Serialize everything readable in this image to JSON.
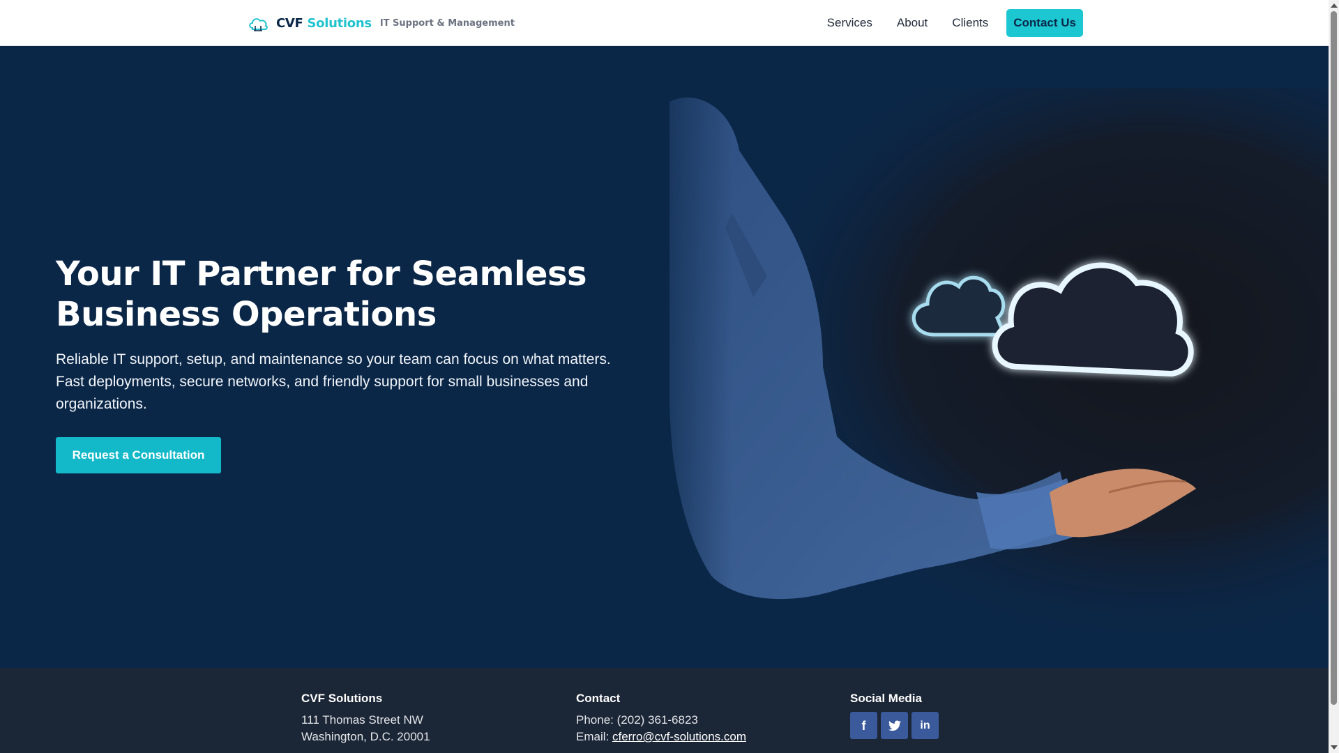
{
  "header": {
    "brand_main": "CVF",
    "brand_accent": "Solutions",
    "tagline": "IT Support & Management",
    "nav": [
      {
        "label": "Services"
      },
      {
        "label": "About"
      },
      {
        "label": "Clients"
      }
    ],
    "cta_label": "Contact Us"
  },
  "hero": {
    "title": "Your IT Partner for Seamless Business Operations",
    "description": "Reliable IT support, setup, and maintenance so your team can focus on what matters. Fast deployments, secure networks, and friendly support for small businesses and organizations.",
    "button_label": "Request a Consultation"
  },
  "footer": {
    "company": {
      "heading": "CVF Solutions",
      "address_line1": "111 Thomas Street NW",
      "address_line2": "Washington, D.C. 20001"
    },
    "contact": {
      "heading": "Contact",
      "phone_label": "Phone:",
      "phone": "(202) 361-6823",
      "email_label": "Email:",
      "email": "cferro@cvf-solutions.com"
    },
    "social": {
      "heading": "Social Media",
      "icons": [
        "facebook-icon",
        "twitter-icon",
        "linkedin-icon"
      ],
      "facebook_glyph": "f",
      "linkedin_glyph": "in"
    }
  },
  "colors": {
    "accent": "#1cc7d2",
    "hero_bg": "#0b2748",
    "footer_bg": "#1b2636",
    "social_btn": "#3a5a9c"
  }
}
